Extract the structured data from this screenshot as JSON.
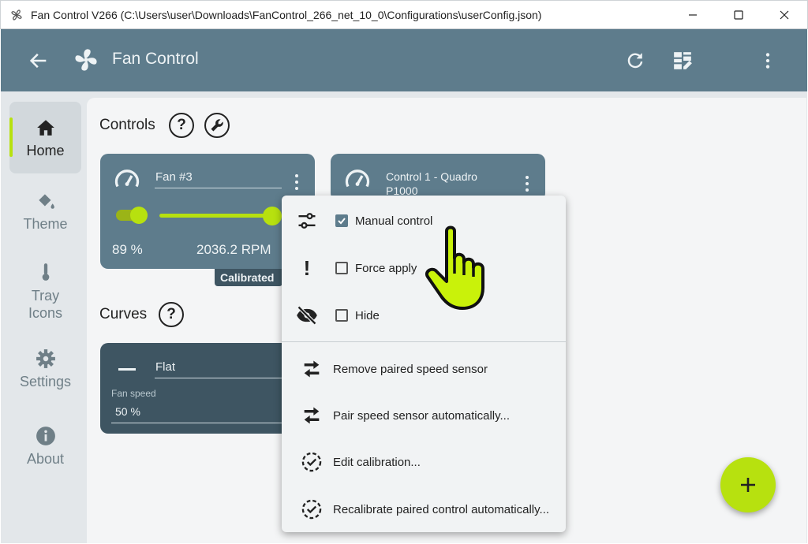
{
  "window": {
    "title": "Fan Control V266 (C:\\Users\\user\\Downloads\\FanControl_266_net_10_0\\Configurations\\userConfig.json)",
    "buttons": [
      "minimize-icon",
      "maximize-icon",
      "close-icon"
    ]
  },
  "header": {
    "title": "Fan Control",
    "icons": [
      "back-arrow-icon",
      "fan-logo-icon",
      "refresh-icon",
      "dashboard-edit-icon",
      "more-vertical-icon"
    ]
  },
  "colors": {
    "accent": "#b7e10f",
    "header": "#5e7c8c",
    "card_dark": "#3e5562",
    "background": "#e3e7ea"
  },
  "sidebar": {
    "items": [
      {
        "label": "Home",
        "icon": "home-icon",
        "active": true
      },
      {
        "label": "Theme",
        "icon": "paint-bucket-icon"
      },
      {
        "label": "Tray\nIcons",
        "icon": "thermometer-icon"
      },
      {
        "label": "Settings",
        "icon": "gear-icon"
      },
      {
        "label": "About",
        "icon": "info-icon"
      }
    ]
  },
  "controls": {
    "title": "Controls",
    "cards": [
      {
        "name": "Fan #3",
        "percent": "89 %",
        "rpm": "2036.2 RPM",
        "slider_value": 89,
        "badge": "Calibrated"
      },
      {
        "name": "Control 1 - Quadro P1000"
      }
    ]
  },
  "curves": {
    "title": "Curves",
    "cards": [
      {
        "name": "Flat",
        "field_label": "Fan speed",
        "field_value": "50 %"
      }
    ]
  },
  "context_menu": {
    "check_items": [
      {
        "label": "Manual control",
        "checked": true,
        "icon": "tune-sliders-icon"
      },
      {
        "label": "Force apply",
        "checked": false,
        "icon": "exclamation-icon"
      },
      {
        "label": "Hide",
        "checked": false,
        "icon": "eye-off-icon"
      }
    ],
    "action_items": [
      {
        "label": "Remove paired speed sensor",
        "icon": "swap-arrows-icon"
      },
      {
        "label": "Pair speed sensor automatically...",
        "icon": "swap-arrows-icon"
      },
      {
        "label": "Edit calibration...",
        "icon": "dashed-check-circle-icon"
      },
      {
        "label": "Recalibrate paired control automatically...",
        "icon": "dashed-check-circle-icon"
      }
    ]
  },
  "fab": {
    "icon": "plus-icon"
  }
}
